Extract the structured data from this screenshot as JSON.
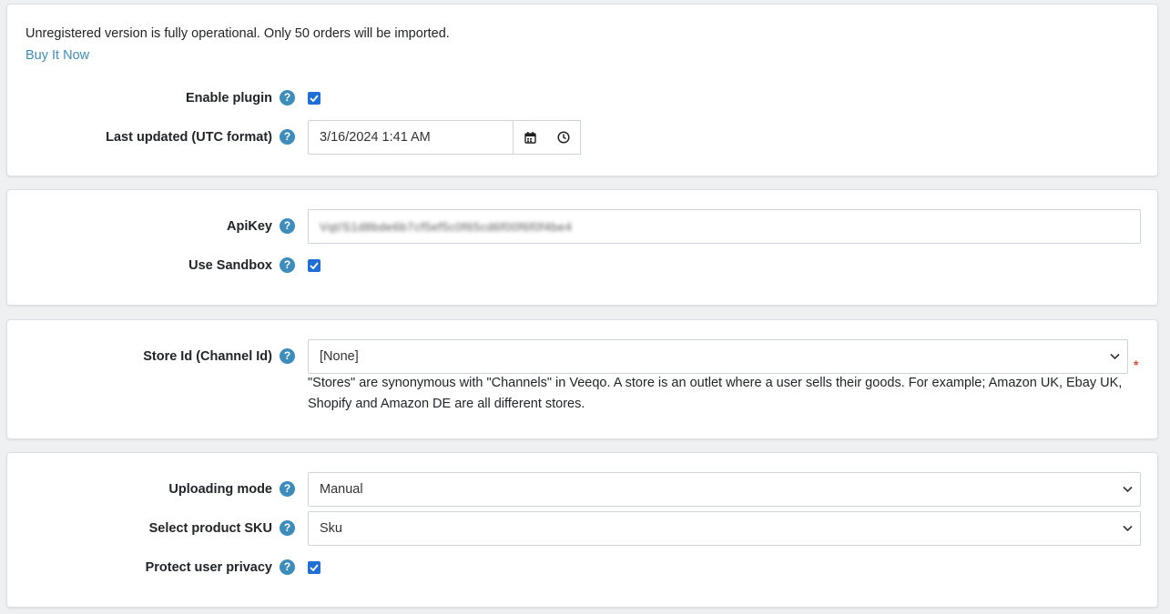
{
  "license": {
    "notice": "Unregistered version is fully operational. Only 50 orders will be imported.",
    "buy_link": "Buy It Now"
  },
  "general": {
    "enable_plugin": {
      "label": "Enable plugin",
      "checked": true
    },
    "last_updated": {
      "label": "Last updated (UTC format)",
      "value": "3/16/2024 1:41 AM"
    }
  },
  "api": {
    "api_key": {
      "label": "ApiKey",
      "value": "Vqt/S1d8bde6b7cf5ef5c0f65cd6f00f6f0f4be4"
    },
    "use_sandbox": {
      "label": "Use Sandbox",
      "checked": true
    }
  },
  "store": {
    "store_id": {
      "label": "Store Id (Channel Id)",
      "value": "[None]",
      "required_mark": "*"
    },
    "hint": "\"Stores\" are synonymous with \"Channels\" in Veeqo. A store is an outlet where a user sells their goods. For example; Amazon UK, Ebay UK, Shopify and Amazon DE are all different stores."
  },
  "upload": {
    "uploading_mode": {
      "label": "Uploading mode",
      "value": "Manual"
    },
    "product_sku": {
      "label": "Select product SKU",
      "value": "Sku"
    },
    "protect_privacy": {
      "label": "Protect user privacy",
      "checked": true
    }
  },
  "icons": {
    "help": "question-circle-icon",
    "calendar": "calendar-icon",
    "clock": "clock-icon",
    "chevron": "chevron-down-icon",
    "checkmark": "checkmark-icon"
  },
  "colors": {
    "help": "#3c8dbc",
    "link": "#3c8dbc",
    "checkbox": "#1f6fd6",
    "required": "#dd4b39"
  }
}
